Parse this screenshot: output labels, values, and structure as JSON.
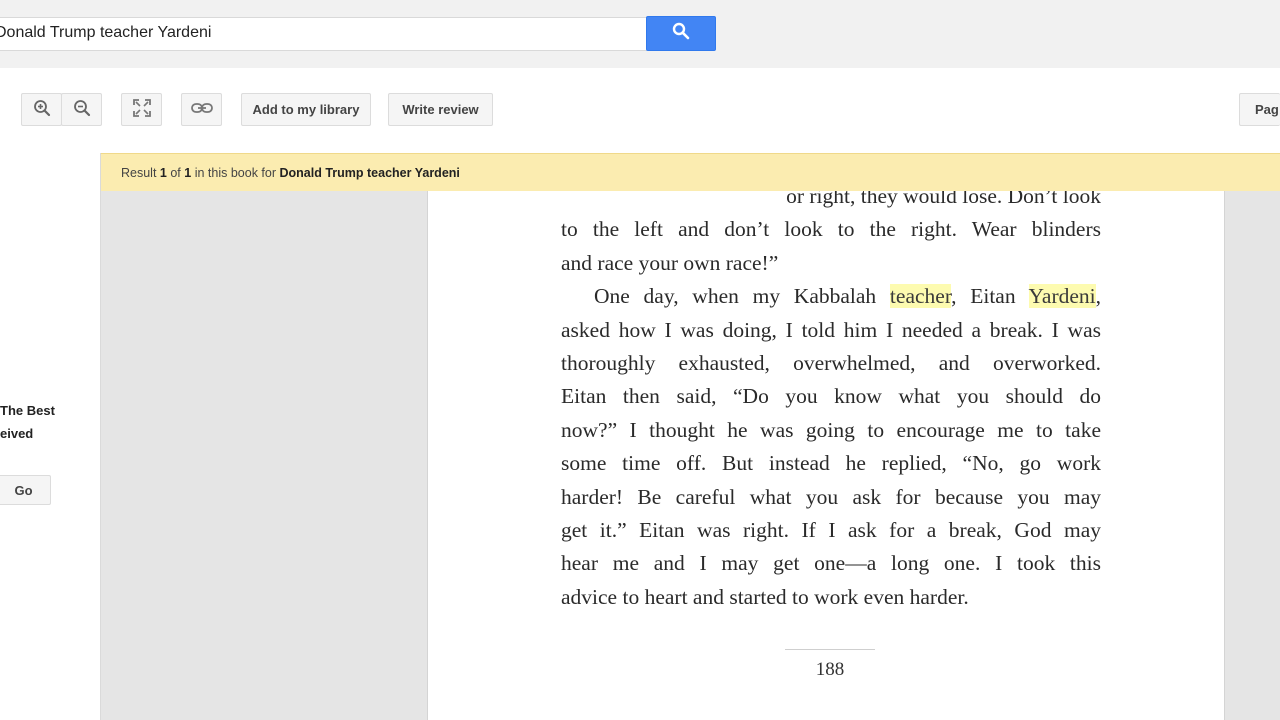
{
  "search": {
    "value": "Donald Trump teacher Yardeni",
    "button_icon": "search-icon",
    "button_color": "#4285f4"
  },
  "toolbar": {
    "zoom_in_icon": "zoom-in-icon",
    "zoom_out_icon": "zoom-out-icon",
    "fullscreen_icon": "fullscreen-icon",
    "link_icon": "link-icon",
    "add_library_label": "Add to my library",
    "write_review_label": "Write review",
    "page_label": "Pag"
  },
  "sidebar": {
    "line1": "The Best",
    "line2": "eived",
    "go_label": "Go"
  },
  "result": {
    "prefix": "Result",
    "current": "1",
    "of": "of",
    "total": "1",
    "middle": "in this book for",
    "query": "Donald Trump teacher Yardeni",
    "bar_color": "#fbecb0"
  },
  "book": {
    "lines": [
      {
        "pre": "or right, they would lose. Don’t look",
        "hl": "",
        "mid": "",
        "hl2": "",
        "post": ""
      },
      {
        "pre": "to the left and don’t look to the right. Wear blinders",
        "hl": "",
        "mid": "",
        "hl2": "",
        "post": ""
      },
      {
        "pre": "and race your own race!”",
        "hl": "",
        "mid": "",
        "hl2": "",
        "post": ""
      },
      {
        "pre": "One day, when my Kabbalah ",
        "hl": "teacher",
        "mid": ", Eitan ",
        "hl2": "Yardeni",
        "post": ","
      },
      {
        "pre": "asked how I was doing, I told him I needed a break. I was",
        "hl": "",
        "mid": "",
        "hl2": "",
        "post": ""
      },
      {
        "pre": "thoroughly exhausted, overwhelmed, and overworked.",
        "hl": "",
        "mid": "",
        "hl2": "",
        "post": ""
      },
      {
        "pre": "Eitan then said, “Do you know what you should do",
        "hl": "",
        "mid": "",
        "hl2": "",
        "post": ""
      },
      {
        "pre": "now?” I thought he was going to encourage me to take",
        "hl": "",
        "mid": "",
        "hl2": "",
        "post": ""
      },
      {
        "pre": "some time off. But instead he replied, “No, go work",
        "hl": "",
        "mid": "",
        "hl2": "",
        "post": ""
      },
      {
        "pre": "harder! Be careful what you ask for because you may",
        "hl": "",
        "mid": "",
        "hl2": "",
        "post": ""
      },
      {
        "pre": "get it.” Eitan was right. If I ask for a break, God may",
        "hl": "",
        "mid": "",
        "hl2": "",
        "post": ""
      },
      {
        "pre": "hear me and I may get one—a long one. I took this",
        "hl": "",
        "mid": "",
        "hl2": "",
        "post": ""
      },
      {
        "pre": "advice to heart and started to work even harder.",
        "hl": "",
        "mid": "",
        "hl2": "",
        "post": ""
      }
    ],
    "page_number": "188",
    "highlight_color": "#fdfbb0"
  }
}
